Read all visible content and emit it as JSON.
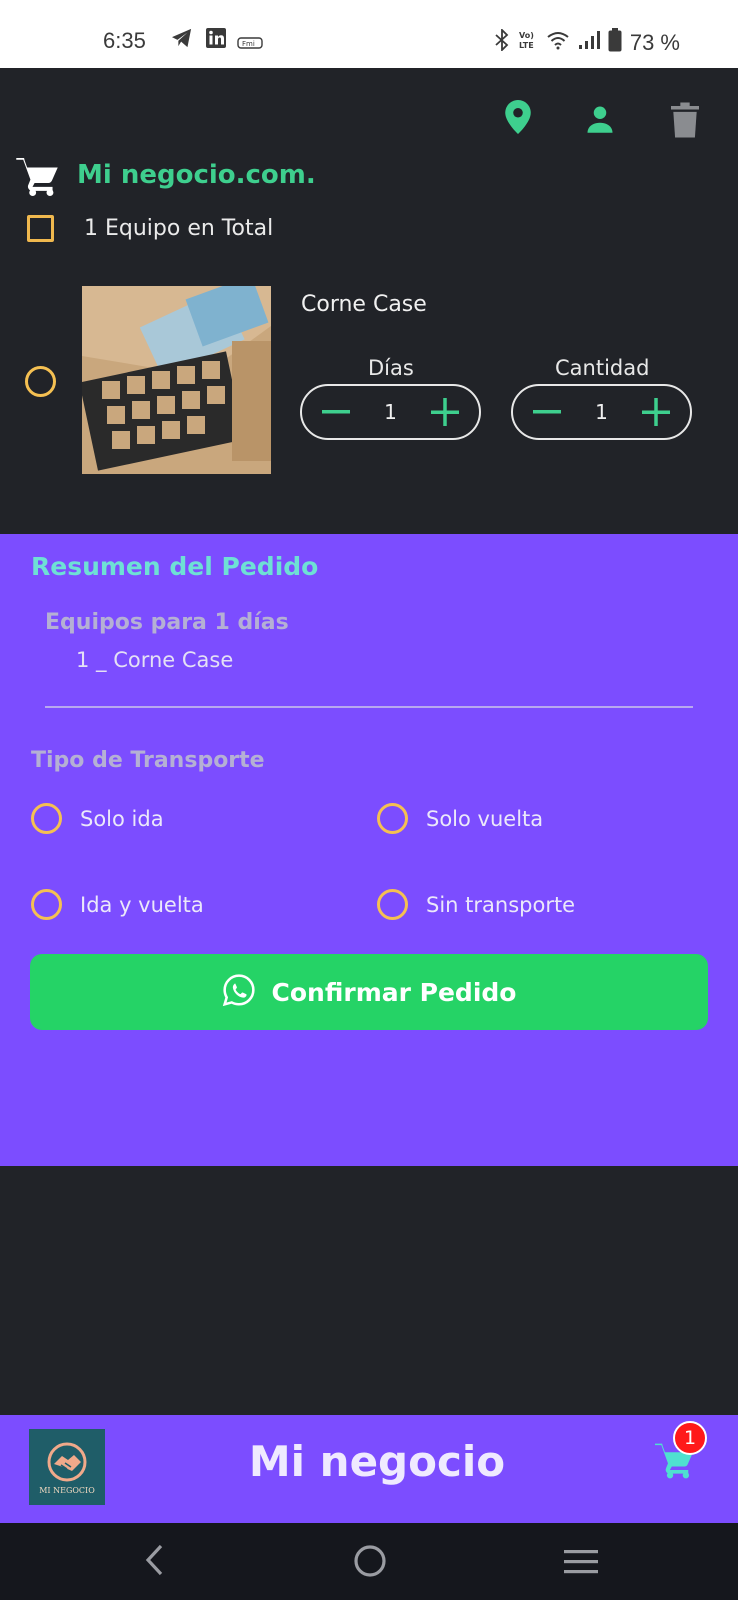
{
  "status_bar": {
    "time": "6:35",
    "battery": "73 %",
    "icons": [
      "telegram-icon",
      "linkedin-icon",
      "app-notification-icon",
      "bluetooth-icon",
      "volte-icon",
      "wifi-icon",
      "signal-icon",
      "battery-icon"
    ]
  },
  "header": {
    "icons": [
      "location-pin-icon",
      "person-icon",
      "trash-icon"
    ],
    "brand_title": "Mi negocio.com.",
    "total_label": "1 Equipo en Total"
  },
  "item": {
    "name": "Corne Case",
    "days_label": "Días",
    "days_value": "1",
    "qty_label": "Cantidad",
    "qty_value": "1"
  },
  "summary": {
    "title": "Resumen del Pedido",
    "equip_heading": "Equipos para 1 días",
    "equip_line": "1 _ Corne Case",
    "transport_heading": "Tipo de Transporte",
    "options": [
      "Solo ida",
      "Solo vuelta",
      "Ida y vuelta",
      "Sin transporte"
    ],
    "confirm_label": "Confirmar Pedido"
  },
  "app_bar": {
    "logo_text": "MI NEGOCIO",
    "title": "Mi negocio",
    "cart_count": "1"
  },
  "colors": {
    "background": "#212328",
    "accent_green": "#3ecf8e",
    "purple": "#7c4dff",
    "radio_orange": "#f5c052",
    "whatsapp_green": "#25d366",
    "badge_red": "#ff1a1a"
  }
}
